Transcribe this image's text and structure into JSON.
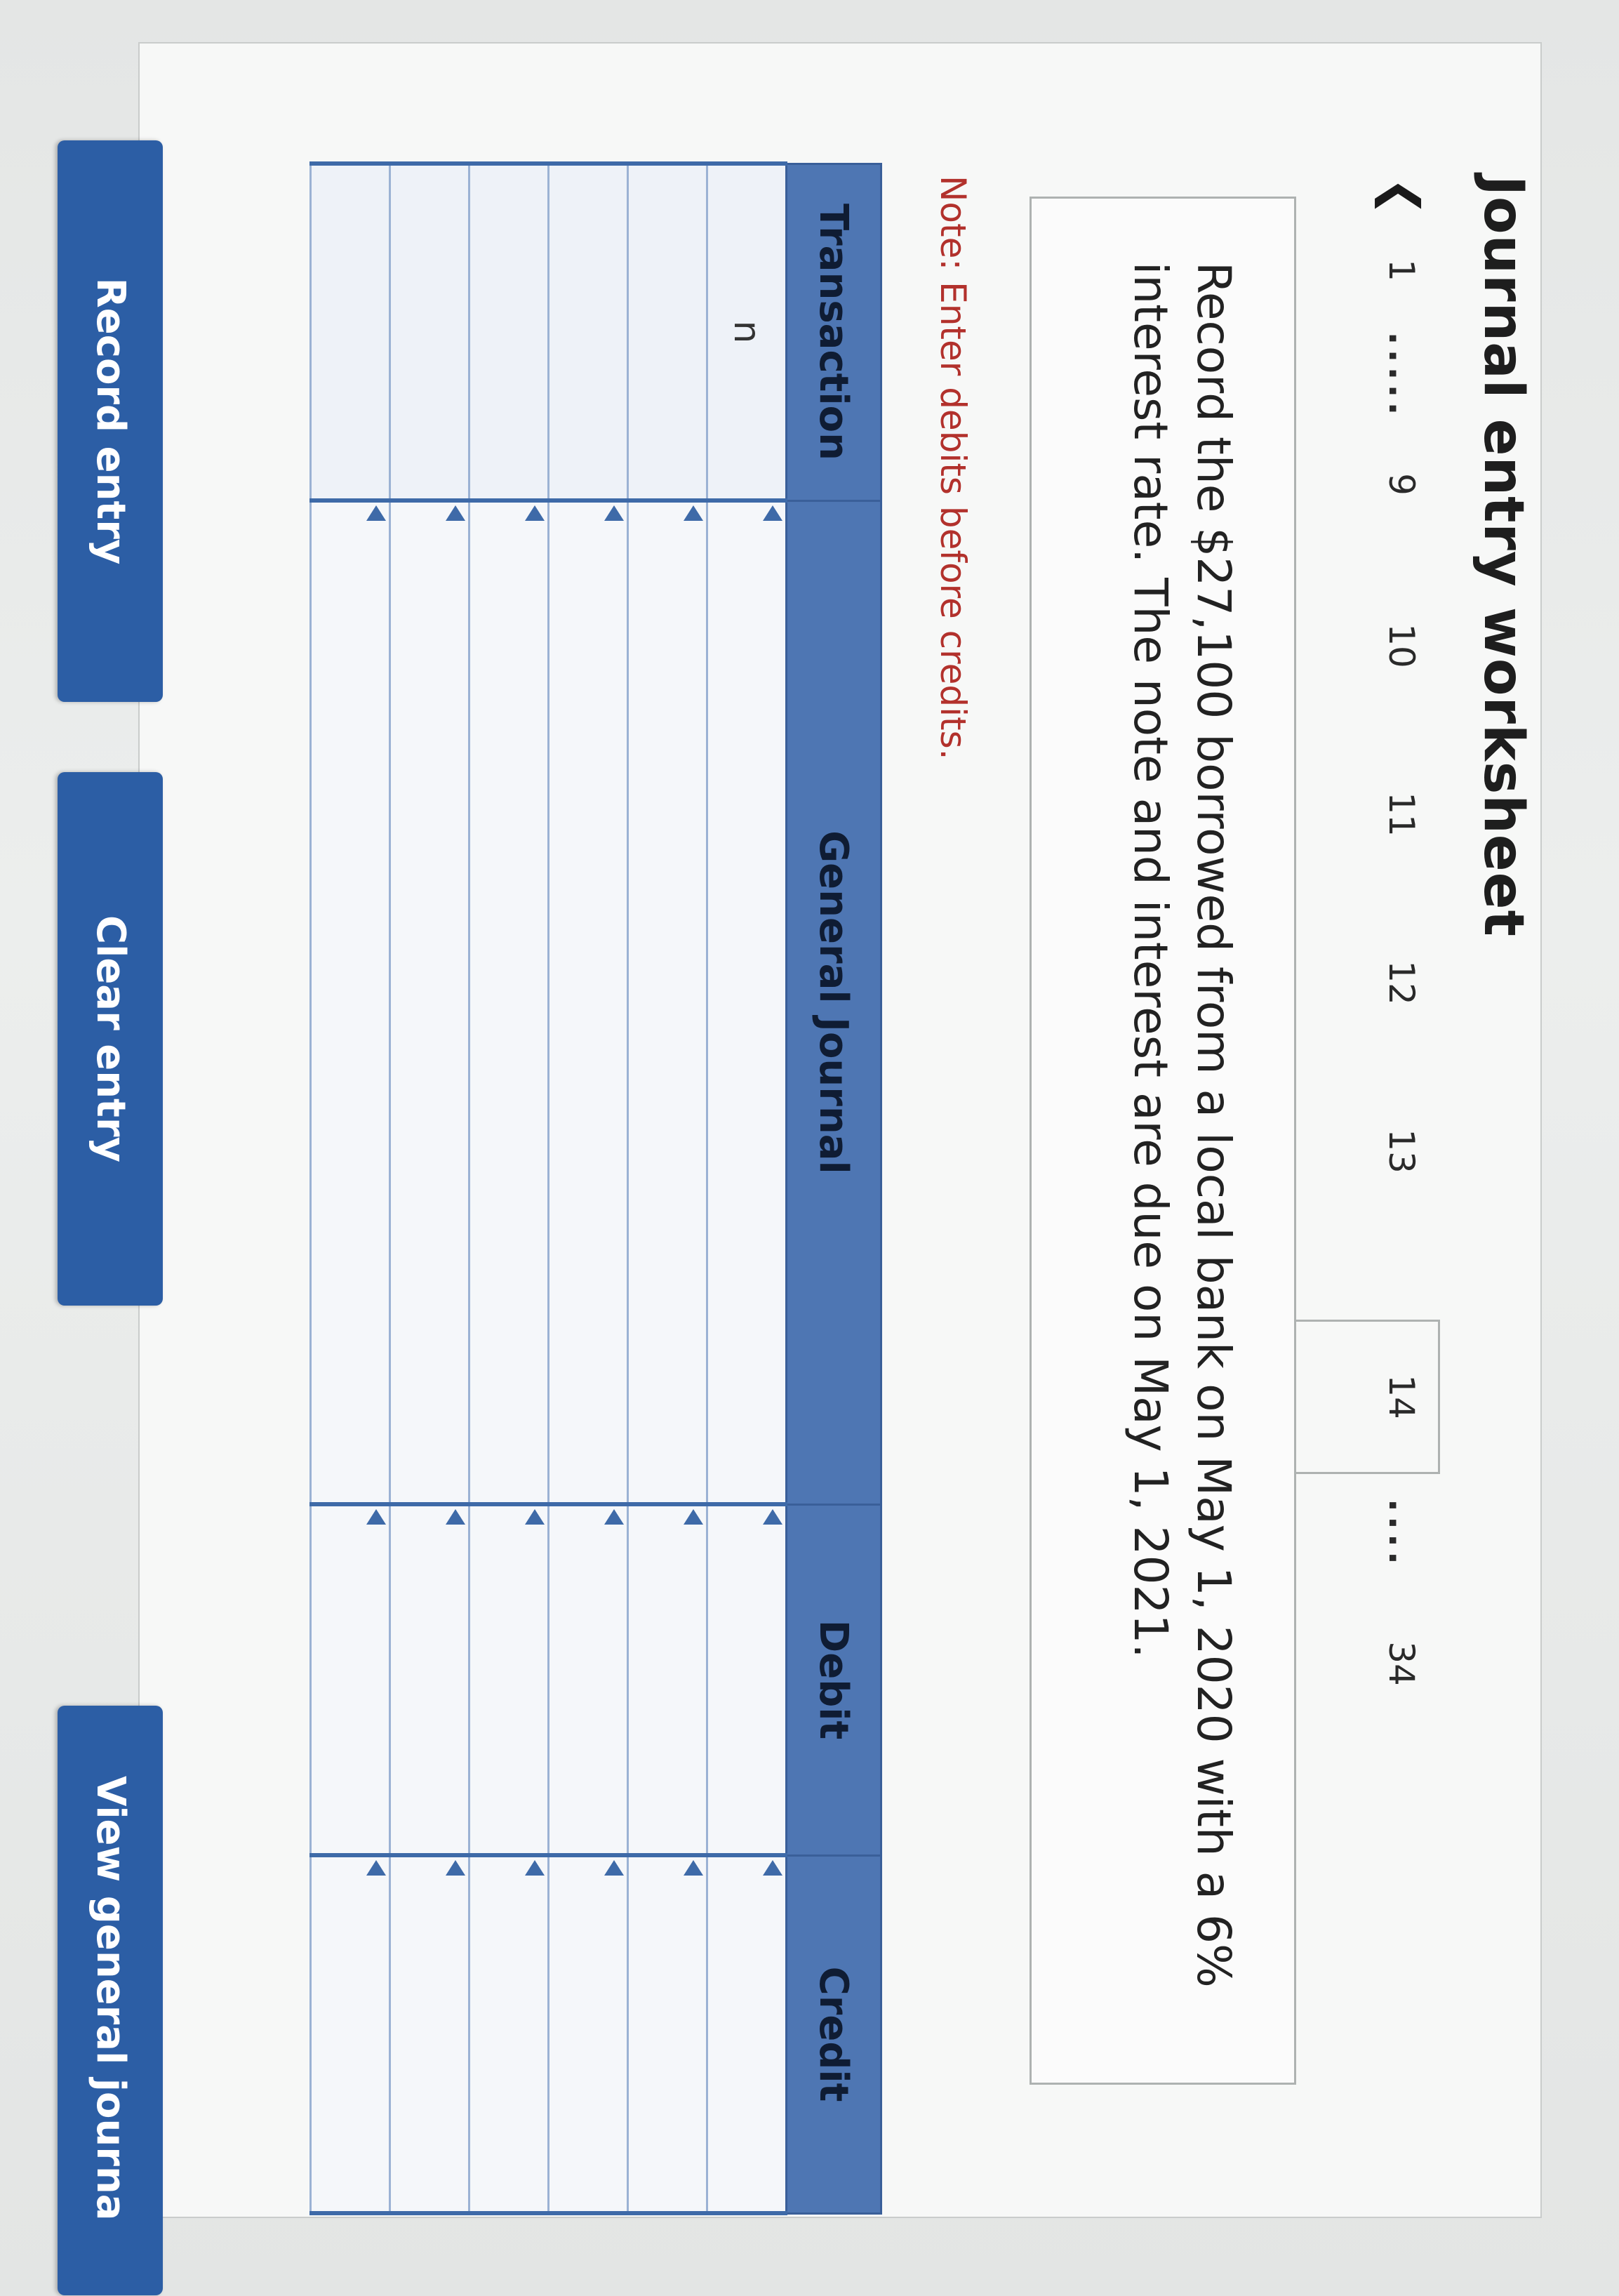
{
  "worksheet": {
    "title": "Journal entry worksheet"
  },
  "pagination": {
    "prev_icon": "chevron-left",
    "items": [
      "1",
      ".....",
      "9",
      "10",
      "11",
      "12",
      "13",
      "14",
      "....",
      "34"
    ],
    "active": "14"
  },
  "question": {
    "text": "Record the $27,100 borrowed from a local bank on May 1, 2020 with a 6% interest rate. The note and interest are due on May 1, 2021."
  },
  "note": {
    "text": "Note: Enter debits before credits."
  },
  "journal": {
    "headers": {
      "transaction": "Transaction",
      "general_journal": "General Journal",
      "debit": "Debit",
      "credit": "Credit"
    },
    "rows": [
      {
        "transaction": "n",
        "account": "",
        "debit": "",
        "credit": ""
      },
      {
        "transaction": "",
        "account": "",
        "debit": "",
        "credit": ""
      },
      {
        "transaction": "",
        "account": "",
        "debit": "",
        "credit": ""
      },
      {
        "transaction": "",
        "account": "",
        "debit": "",
        "credit": ""
      },
      {
        "transaction": "",
        "account": "",
        "debit": "",
        "credit": ""
      },
      {
        "transaction": "",
        "account": "",
        "debit": "",
        "credit": ""
      }
    ]
  },
  "buttons": {
    "record": "Record entry",
    "clear": "Clear entry",
    "view": "View general journa"
  },
  "colors": {
    "header_bg": "#4e76b3",
    "button_bg": "#2c5ea5",
    "note_text": "#b2312c"
  }
}
